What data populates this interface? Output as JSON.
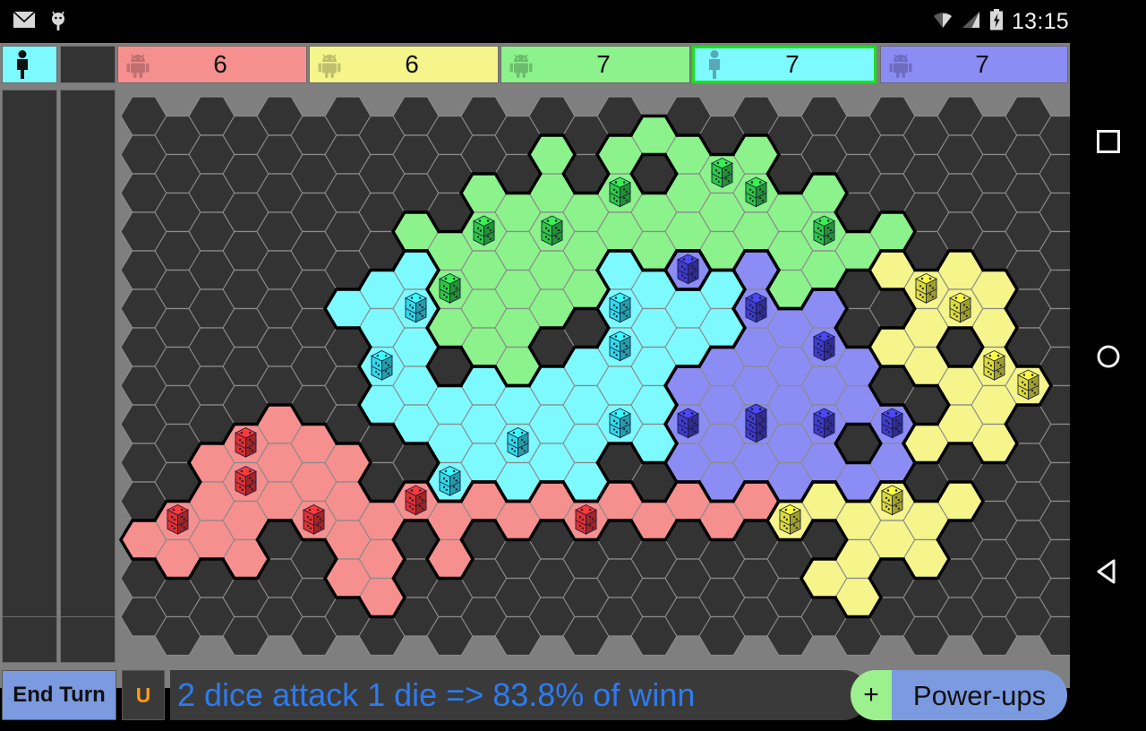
{
  "status_bar": {
    "icons": [
      "mail-icon",
      "android-bug-icon",
      "wifi-icon",
      "signal-icon",
      "battery-charging-icon"
    ],
    "clock": "13:15"
  },
  "nav_bar": {
    "recents_label": "Recents",
    "home_label": "Home",
    "back_label": "Back"
  },
  "players": [
    {
      "id": 0,
      "kind": "human",
      "icon": "person-icon",
      "color": "#7dfaff",
      "count": "",
      "active": false,
      "self_slot": true
    },
    {
      "id": 1,
      "kind": "empty",
      "icon": "",
      "color": "#333333",
      "count": "",
      "active": false,
      "self_slot": false
    },
    {
      "id": 2,
      "kind": "computer",
      "icon": "android-icon",
      "color": "#f5908f",
      "count": "6",
      "active": false,
      "self_slot": false
    },
    {
      "id": 3,
      "kind": "computer",
      "icon": "android-icon",
      "color": "#f5f58c",
      "count": "6",
      "active": false,
      "self_slot": false
    },
    {
      "id": 4,
      "kind": "computer",
      "icon": "android-icon",
      "color": "#8cf28c",
      "count": "7",
      "active": false,
      "self_slot": false
    },
    {
      "id": 5,
      "kind": "human",
      "icon": "person-icon",
      "color": "#7dfaff",
      "count": "7",
      "active": true,
      "self_slot": false
    },
    {
      "id": 6,
      "kind": "computer",
      "icon": "android-icon",
      "color": "#8c8cf5",
      "count": "7",
      "active": false,
      "self_slot": false
    }
  ],
  "bottom_bar": {
    "end_turn_label": "End Turn",
    "undo_label": "U",
    "message": "2 dice attack 1 die => 83.8% of winn",
    "plus_label": "+",
    "powerups_label": "Power-ups"
  },
  "board": {
    "background_color": "#7f7f7f",
    "empty_hex_color": "#333333",
    "grid_line_color": "#8a8a8a",
    "border_color": "#000000",
    "cols": 28,
    "rows": 15,
    "hex_width": 51,
    "hex_step_x": 38,
    "hex_height": 43,
    "player_colors": {
      "red": "#f5908f",
      "yellow": "#f5f58c",
      "green": "#8cf28c",
      "cyan": "#7dfaff",
      "blue": "#8c8cf5"
    },
    "dice_colors": {
      "red": "#e02a2a",
      "yellow": "#dada30",
      "green": "#27c53f",
      "cyan": "#2bd7e8",
      "blue": "#3a36c8"
    },
    "territories": [
      {
        "owner": "green",
        "dice": 0,
        "col": 15,
        "row": 0
      },
      {
        "owner": "green",
        "dice": 0,
        "col": 12,
        "row": 1
      },
      {
        "owner": "green",
        "dice": 0,
        "col": 14,
        "row": 1
      },
      {
        "owner": "green",
        "dice": 0,
        "col": 16,
        "row": 1
      },
      {
        "owner": "green",
        "dice": 2,
        "col": 17,
        "row": 1
      },
      {
        "owner": "green",
        "dice": 0,
        "col": 18,
        "row": 1
      },
      {
        "owner": "green",
        "dice": 0,
        "col": 10,
        "row": 2
      },
      {
        "owner": "green",
        "dice": 0,
        "col": 11,
        "row": 2
      },
      {
        "owner": "green",
        "dice": 0,
        "col": 12,
        "row": 2
      },
      {
        "owner": "green",
        "dice": 0,
        "col": 13,
        "row": 2
      },
      {
        "owner": "green",
        "dice": 2,
        "col": 14,
        "row": 2
      },
      {
        "owner": "green",
        "dice": 0,
        "col": 15,
        "row": 2
      },
      {
        "owner": "green",
        "dice": 0,
        "col": 16,
        "row": 2
      },
      {
        "owner": "green",
        "dice": 0,
        "col": 17,
        "row": 2
      },
      {
        "owner": "green",
        "dice": 2,
        "col": 18,
        "row": 2
      },
      {
        "owner": "green",
        "dice": 0,
        "col": 19,
        "row": 2
      },
      {
        "owner": "green",
        "dice": 0,
        "col": 20,
        "row": 2
      },
      {
        "owner": "green",
        "dice": 0,
        "col": 8,
        "row": 3
      },
      {
        "owner": "green",
        "dice": 0,
        "col": 9,
        "row": 3
      },
      {
        "owner": "green",
        "dice": 2,
        "col": 10,
        "row": 3
      },
      {
        "owner": "green",
        "dice": 0,
        "col": 11,
        "row": 3
      },
      {
        "owner": "green",
        "dice": 2,
        "col": 12,
        "row": 3
      },
      {
        "owner": "green",
        "dice": 0,
        "col": 13,
        "row": 3
      },
      {
        "owner": "green",
        "dice": 0,
        "col": 14,
        "row": 3
      },
      {
        "owner": "green",
        "dice": 0,
        "col": 15,
        "row": 3
      },
      {
        "owner": "green",
        "dice": 0,
        "col": 16,
        "row": 3
      },
      {
        "owner": "green",
        "dice": 0,
        "col": 17,
        "row": 3
      },
      {
        "owner": "green",
        "dice": 0,
        "col": 18,
        "row": 3
      },
      {
        "owner": "green",
        "dice": 0,
        "col": 19,
        "row": 3
      },
      {
        "owner": "green",
        "dice": 2,
        "col": 20,
        "row": 3
      },
      {
        "owner": "green",
        "dice": 0,
        "col": 21,
        "row": 3
      },
      {
        "owner": "green",
        "dice": 0,
        "col": 22,
        "row": 3
      },
      {
        "owner": "green",
        "dice": 2,
        "col": 9,
        "row": 4
      },
      {
        "owner": "green",
        "dice": 0,
        "col": 10,
        "row": 4
      },
      {
        "owner": "green",
        "dice": 0,
        "col": 11,
        "row": 4
      },
      {
        "owner": "green",
        "dice": 0,
        "col": 12,
        "row": 4
      },
      {
        "owner": "green",
        "dice": 0,
        "col": 13,
        "row": 4
      },
      {
        "owner": "green",
        "dice": 0,
        "col": 19,
        "row": 4
      },
      {
        "owner": "green",
        "dice": 0,
        "col": 20,
        "row": 4
      },
      {
        "owner": "green",
        "dice": 0,
        "col": 9,
        "row": 5
      },
      {
        "owner": "green",
        "dice": 0,
        "col": 10,
        "row": 5
      },
      {
        "owner": "green",
        "dice": 0,
        "col": 11,
        "row": 5
      },
      {
        "owner": "green",
        "dice": 0,
        "col": 12,
        "row": 5
      },
      {
        "owner": "green",
        "dice": 0,
        "col": 10,
        "row": 6
      },
      {
        "owner": "green",
        "dice": 0,
        "col": 11,
        "row": 6
      },
      {
        "owner": "cyan",
        "dice": 0,
        "col": 7,
        "row": 4
      },
      {
        "owner": "cyan",
        "dice": 0,
        "col": 8,
        "row": 4
      },
      {
        "owner": "cyan",
        "dice": 2,
        "col": 8,
        "row": 5
      },
      {
        "owner": "cyan",
        "dice": 0,
        "col": 14,
        "row": 4
      },
      {
        "owner": "cyan",
        "dice": 0,
        "col": 15,
        "row": 4
      },
      {
        "owner": "cyan",
        "dice": 0,
        "col": 16,
        "row": 4
      },
      {
        "owner": "cyan",
        "dice": 0,
        "col": 17,
        "row": 4
      },
      {
        "owner": "cyan",
        "dice": 2,
        "col": 14,
        "row": 5
      },
      {
        "owner": "cyan",
        "dice": 0,
        "col": 15,
        "row": 5
      },
      {
        "owner": "cyan",
        "dice": 0,
        "col": 16,
        "row": 5
      },
      {
        "owner": "cyan",
        "dice": 0,
        "col": 17,
        "row": 5
      },
      {
        "owner": "cyan",
        "dice": 0,
        "col": 6,
        "row": 5
      },
      {
        "owner": "cyan",
        "dice": 0,
        "col": 7,
        "row": 5
      },
      {
        "owner": "cyan",
        "dice": 2,
        "col": 7,
        "row": 6
      },
      {
        "owner": "cyan",
        "dice": 0,
        "col": 8,
        "row": 6
      },
      {
        "owner": "cyan",
        "dice": 0,
        "col": 13,
        "row": 6
      },
      {
        "owner": "cyan",
        "dice": 2,
        "col": 14,
        "row": 6
      },
      {
        "owner": "cyan",
        "dice": 0,
        "col": 15,
        "row": 6
      },
      {
        "owner": "cyan",
        "dice": 0,
        "col": 16,
        "row": 6
      },
      {
        "owner": "cyan",
        "dice": 0,
        "col": 7,
        "row": 7
      },
      {
        "owner": "cyan",
        "dice": 0,
        "col": 8,
        "row": 7
      },
      {
        "owner": "cyan",
        "dice": 0,
        "col": 9,
        "row": 7
      },
      {
        "owner": "cyan",
        "dice": 0,
        "col": 10,
        "row": 7
      },
      {
        "owner": "cyan",
        "dice": 0,
        "col": 11,
        "row": 7
      },
      {
        "owner": "cyan",
        "dice": 0,
        "col": 12,
        "row": 7
      },
      {
        "owner": "cyan",
        "dice": 0,
        "col": 13,
        "row": 7
      },
      {
        "owner": "cyan",
        "dice": 0,
        "col": 14,
        "row": 7
      },
      {
        "owner": "cyan",
        "dice": 0,
        "col": 15,
        "row": 7
      },
      {
        "owner": "cyan",
        "dice": 0,
        "col": 8,
        "row": 8
      },
      {
        "owner": "cyan",
        "dice": 0,
        "col": 9,
        "row": 8
      },
      {
        "owner": "cyan",
        "dice": 0,
        "col": 10,
        "row": 8
      },
      {
        "owner": "cyan",
        "dice": 2,
        "col": 11,
        "row": 8
      },
      {
        "owner": "cyan",
        "dice": 0,
        "col": 12,
        "row": 8
      },
      {
        "owner": "cyan",
        "dice": 0,
        "col": 13,
        "row": 8
      },
      {
        "owner": "cyan",
        "dice": 2,
        "col": 14,
        "row": 8
      },
      {
        "owner": "cyan",
        "dice": 0,
        "col": 15,
        "row": 8
      },
      {
        "owner": "cyan",
        "dice": 0,
        "col": 9,
        "row": 9
      },
      {
        "owner": "cyan",
        "dice": 2,
        "col": 9,
        "row": 9
      },
      {
        "owner": "cyan",
        "dice": 0,
        "col": 10,
        "row": 9
      },
      {
        "owner": "cyan",
        "dice": 0,
        "col": 11,
        "row": 9
      },
      {
        "owner": "cyan",
        "dice": 0,
        "col": 12,
        "row": 9
      },
      {
        "owner": "cyan",
        "dice": 0,
        "col": 13,
        "row": 9
      },
      {
        "owner": "blue",
        "dice": 2,
        "col": 16,
        "row": 4
      },
      {
        "owner": "blue",
        "dice": 0,
        "col": 18,
        "row": 4
      },
      {
        "owner": "blue",
        "dice": 0,
        "col": 19,
        "row": 5
      },
      {
        "owner": "blue",
        "dice": 2,
        "col": 18,
        "row": 5
      },
      {
        "owner": "blue",
        "dice": 0,
        "col": 20,
        "row": 5
      },
      {
        "owner": "blue",
        "dice": 2,
        "col": 20,
        "row": 6
      },
      {
        "owner": "blue",
        "dice": 0,
        "col": 17,
        "row": 6
      },
      {
        "owner": "blue",
        "dice": 0,
        "col": 18,
        "row": 6
      },
      {
        "owner": "blue",
        "dice": 0,
        "col": 19,
        "row": 6
      },
      {
        "owner": "blue",
        "dice": 0,
        "col": 21,
        "row": 6
      },
      {
        "owner": "blue",
        "dice": 0,
        "col": 16,
        "row": 7
      },
      {
        "owner": "blue",
        "dice": 0,
        "col": 17,
        "row": 7
      },
      {
        "owner": "blue",
        "dice": 0,
        "col": 18,
        "row": 7
      },
      {
        "owner": "blue",
        "dice": 0,
        "col": 19,
        "row": 7
      },
      {
        "owner": "blue",
        "dice": 0,
        "col": 20,
        "row": 7
      },
      {
        "owner": "blue",
        "dice": 0,
        "col": 21,
        "row": 7
      },
      {
        "owner": "blue",
        "dice": 2,
        "col": 16,
        "row": 8
      },
      {
        "owner": "blue",
        "dice": 0,
        "col": 17,
        "row": 8
      },
      {
        "owner": "blue",
        "dice": 3,
        "col": 18,
        "row": 8
      },
      {
        "owner": "blue",
        "dice": 0,
        "col": 19,
        "row": 8
      },
      {
        "owner": "blue",
        "dice": 2,
        "col": 20,
        "row": 8
      },
      {
        "owner": "blue",
        "dice": 2,
        "col": 22,
        "row": 8
      },
      {
        "owner": "blue",
        "dice": 0,
        "col": 16,
        "row": 9
      },
      {
        "owner": "blue",
        "dice": 0,
        "col": 17,
        "row": 9
      },
      {
        "owner": "blue",
        "dice": 0,
        "col": 18,
        "row": 9
      },
      {
        "owner": "blue",
        "dice": 0,
        "col": 19,
        "row": 9
      },
      {
        "owner": "blue",
        "dice": 0,
        "col": 20,
        "row": 9
      },
      {
        "owner": "blue",
        "dice": 0,
        "col": 21,
        "row": 9
      },
      {
        "owner": "blue",
        "dice": 0,
        "col": 22,
        "row": 9
      },
      {
        "owner": "yellow",
        "dice": 0,
        "col": 22,
        "row": 4
      },
      {
        "owner": "yellow",
        "dice": 2,
        "col": 23,
        "row": 4
      },
      {
        "owner": "yellow",
        "dice": 0,
        "col": 24,
        "row": 4
      },
      {
        "owner": "yellow",
        "dice": 0,
        "col": 25,
        "row": 4
      },
      {
        "owner": "yellow",
        "dice": 0,
        "col": 23,
        "row": 5
      },
      {
        "owner": "yellow",
        "dice": 2,
        "col": 24,
        "row": 5
      },
      {
        "owner": "yellow",
        "dice": 0,
        "col": 25,
        "row": 5
      },
      {
        "owner": "yellow",
        "dice": 0,
        "col": 22,
        "row": 6
      },
      {
        "owner": "yellow",
        "dice": 0,
        "col": 23,
        "row": 6
      },
      {
        "owner": "yellow",
        "dice": 2,
        "col": 25,
        "row": 6
      },
      {
        "owner": "yellow",
        "dice": 0,
        "col": 24,
        "row": 7
      },
      {
        "owner": "yellow",
        "dice": 0,
        "col": 25,
        "row": 7
      },
      {
        "owner": "yellow",
        "dice": 2,
        "col": 26,
        "row": 7
      },
      {
        "owner": "yellow",
        "dice": 0,
        "col": 23,
        "row": 8
      },
      {
        "owner": "yellow",
        "dice": 0,
        "col": 24,
        "row": 8
      },
      {
        "owner": "yellow",
        "dice": 0,
        "col": 25,
        "row": 8
      },
      {
        "owner": "yellow",
        "dice": 2,
        "col": 19,
        "row": 10
      },
      {
        "owner": "yellow",
        "dice": 0,
        "col": 20,
        "row": 10
      },
      {
        "owner": "yellow",
        "dice": 0,
        "col": 21,
        "row": 10
      },
      {
        "owner": "yellow",
        "dice": 2,
        "col": 22,
        "row": 10
      },
      {
        "owner": "yellow",
        "dice": 0,
        "col": 23,
        "row": 10
      },
      {
        "owner": "yellow",
        "dice": 0,
        "col": 24,
        "row": 10
      },
      {
        "owner": "yellow",
        "dice": 0,
        "col": 21,
        "row": 11
      },
      {
        "owner": "yellow",
        "dice": 0,
        "col": 22,
        "row": 11
      },
      {
        "owner": "yellow",
        "dice": 0,
        "col": 23,
        "row": 11
      },
      {
        "owner": "yellow",
        "dice": 0,
        "col": 20,
        "row": 12
      },
      {
        "owner": "yellow",
        "dice": 0,
        "col": 21,
        "row": 12
      },
      {
        "owner": "red",
        "dice": 2,
        "col": 3,
        "row": 8
      },
      {
        "owner": "red",
        "dice": 0,
        "col": 4,
        "row": 8
      },
      {
        "owner": "red",
        "dice": 0,
        "col": 5,
        "row": 8
      },
      {
        "owner": "red",
        "dice": 0,
        "col": 2,
        "row": 9
      },
      {
        "owner": "red",
        "dice": 2,
        "col": 3,
        "row": 9
      },
      {
        "owner": "red",
        "dice": 0,
        "col": 4,
        "row": 9
      },
      {
        "owner": "red",
        "dice": 0,
        "col": 5,
        "row": 9
      },
      {
        "owner": "red",
        "dice": 0,
        "col": 6,
        "row": 9
      },
      {
        "owner": "red",
        "dice": 2,
        "col": 1,
        "row": 10
      },
      {
        "owner": "red",
        "dice": 0,
        "col": 2,
        "row": 10
      },
      {
        "owner": "red",
        "dice": 0,
        "col": 3,
        "row": 10
      },
      {
        "owner": "red",
        "dice": 0,
        "col": 4,
        "row": 10
      },
      {
        "owner": "red",
        "dice": 2,
        "col": 5,
        "row": 10
      },
      {
        "owner": "red",
        "dice": 0,
        "col": 6,
        "row": 10
      },
      {
        "owner": "red",
        "dice": 0,
        "col": 7,
        "row": 10
      },
      {
        "owner": "red",
        "dice": 2,
        "col": 8,
        "row": 10
      },
      {
        "owner": "red",
        "dice": 0,
        "col": 9,
        "row": 10
      },
      {
        "owner": "red",
        "dice": 0,
        "col": 10,
        "row": 10
      },
      {
        "owner": "red",
        "dice": 0,
        "col": 11,
        "row": 10
      },
      {
        "owner": "red",
        "dice": 0,
        "col": 12,
        "row": 10
      },
      {
        "owner": "red",
        "dice": 2,
        "col": 13,
        "row": 10
      },
      {
        "owner": "red",
        "dice": 0,
        "col": 14,
        "row": 10
      },
      {
        "owner": "red",
        "dice": 0,
        "col": 15,
        "row": 10
      },
      {
        "owner": "red",
        "dice": 0,
        "col": 16,
        "row": 10
      },
      {
        "owner": "red",
        "dice": 0,
        "col": 17,
        "row": 10
      },
      {
        "owner": "red",
        "dice": 0,
        "col": 18,
        "row": 10
      },
      {
        "owner": "red",
        "dice": 0,
        "col": 0,
        "row": 11
      },
      {
        "owner": "red",
        "dice": 0,
        "col": 1,
        "row": 11
      },
      {
        "owner": "red",
        "dice": 0,
        "col": 2,
        "row": 11
      },
      {
        "owner": "red",
        "dice": 0,
        "col": 3,
        "row": 11
      },
      {
        "owner": "red",
        "dice": 0,
        "col": 6,
        "row": 11
      },
      {
        "owner": "red",
        "dice": 0,
        "col": 7,
        "row": 11
      },
      {
        "owner": "red",
        "dice": 0,
        "col": 6,
        "row": 12
      },
      {
        "owner": "red",
        "dice": 0,
        "col": 9,
        "row": 11
      },
      {
        "owner": "red",
        "dice": 0,
        "col": 7,
        "row": 12
      }
    ]
  }
}
